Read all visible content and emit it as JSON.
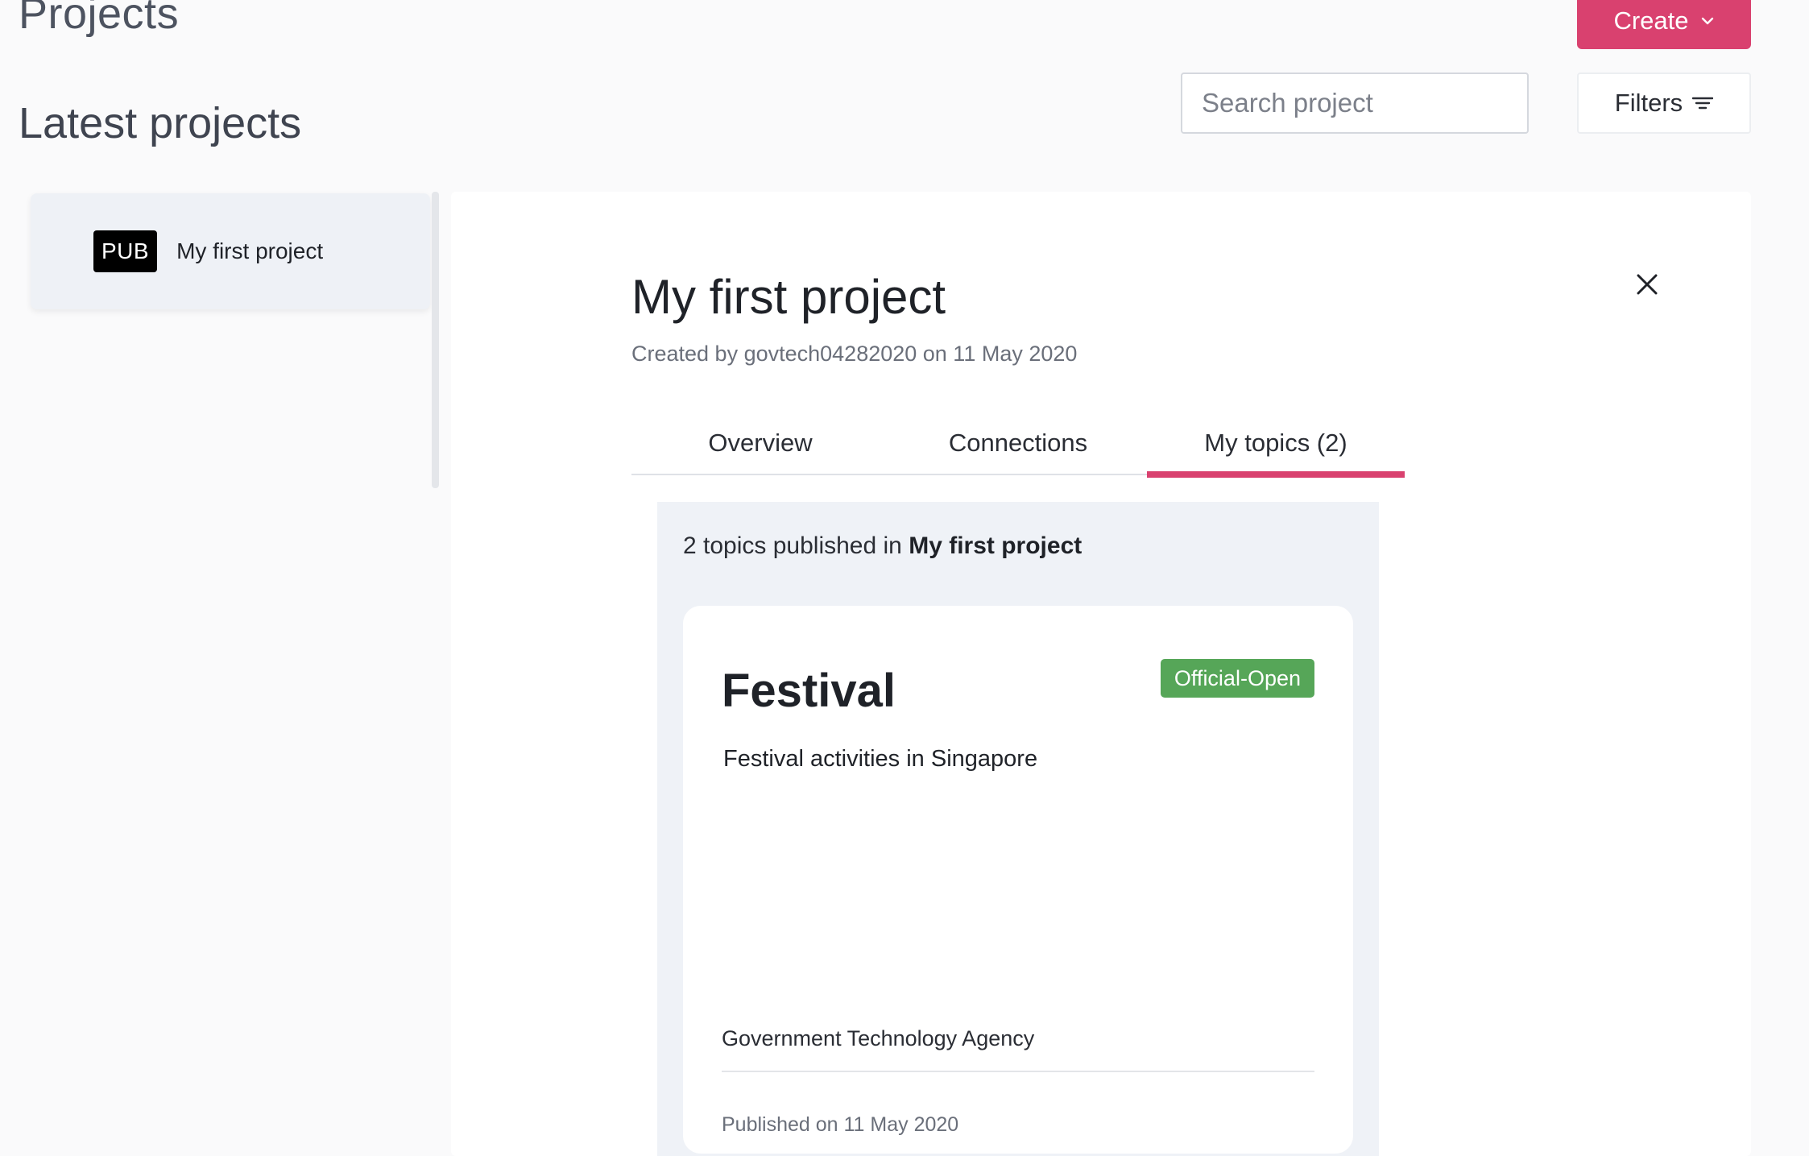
{
  "header": {
    "page_title": "Projects",
    "create_label": "Create",
    "section_title": "Latest projects",
    "search_placeholder": "Search project",
    "filters_label": "Filters"
  },
  "sidebar": {
    "items": [
      {
        "badge": "PUB",
        "label": "My first project"
      }
    ]
  },
  "detail": {
    "title": "My first project",
    "meta": "Created by govtech04282020 on 11 May 2020",
    "tabs": [
      {
        "label": "Overview"
      },
      {
        "label": "Connections"
      },
      {
        "label": "My topics (2)"
      }
    ],
    "topics_summary_prefix": "2 topics published in",
    "topics_summary_project": "My first project",
    "topics": [
      {
        "title": "Festival",
        "description": "Festival activities in Singapore",
        "status": "Official-Open",
        "agency": "Government Technology Agency",
        "published": "Published on 11 May 2020"
      }
    ]
  },
  "colors": {
    "accent": "#d9416f",
    "status_open": "#56a658",
    "badge_bg": "#000000"
  }
}
